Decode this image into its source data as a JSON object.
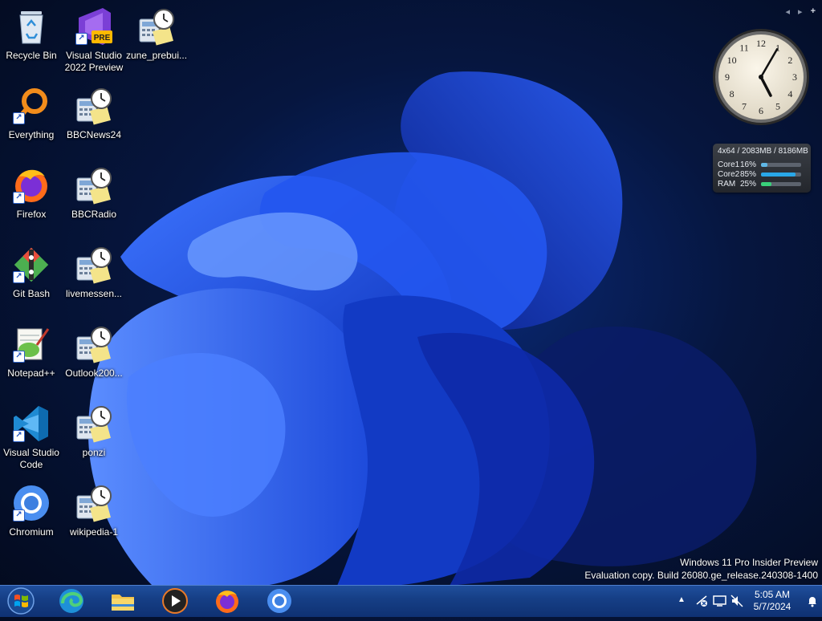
{
  "desktop": {
    "icons": [
      {
        "label": "Recycle Bin"
      },
      {
        "label": "Visual Studio 2022 Preview",
        "badge": "PRE"
      },
      {
        "label": "zune_prebui..."
      },
      {
        "label": "Everything"
      },
      {
        "label": "BBCNews24"
      },
      {
        "label": "Firefox"
      },
      {
        "label": "BBCRadio"
      },
      {
        "label": "Git Bash"
      },
      {
        "label": "livemessen..."
      },
      {
        "label": "Notepad++"
      },
      {
        "label": "Outlook200..."
      },
      {
        "label": "Visual Studio Code"
      },
      {
        "label": "ponzi"
      },
      {
        "label": "Chromium"
      },
      {
        "label": "wikipedia-1"
      }
    ]
  },
  "sidebar": {
    "prev_icon": "chevron-left-icon",
    "next_icon": "chevron-right-icon",
    "add_icon": "plus-icon",
    "add_label": "+"
  },
  "clock_gadget": {
    "numbers": [
      "12",
      "1",
      "2",
      "3",
      "4",
      "5",
      "6",
      "7",
      "8",
      "9",
      "10",
      "11"
    ],
    "hour": 5,
    "minute": 5
  },
  "cpu_gadget": {
    "title": "4x64 / 2083MB / 8186MB",
    "rows": [
      {
        "label": "Core1",
        "value": "16%",
        "fraction": 0.16,
        "color": "#5fb7e6"
      },
      {
        "label": "Core2",
        "value": "85%",
        "fraction": 0.85,
        "color": "#29a7e8"
      },
      {
        "label": "RAM",
        "value": "25%",
        "fraction": 0.25,
        "color": "#39d07a"
      }
    ]
  },
  "watermark": {
    "line1": "Windows 11 Pro Insider Preview",
    "line2": "Evaluation copy. Build 26080.ge_release.240308-1400"
  },
  "taskbar": {
    "start_icon": "windows-start-orb-icon",
    "pinned": [
      "edge-icon",
      "file-explorer-icon",
      "media-player-icon",
      "firefox-icon",
      "chromium-icon"
    ],
    "tray": {
      "time": "5:05 AM",
      "date": "5/7/2024",
      "icons": [
        "show-hidden-icons-chevron",
        "network-disconnected-icon",
        "display-icon",
        "volume-muted-icon",
        "notification-bell-icon"
      ]
    }
  },
  "colors": {
    "accent": "#1f4e9c",
    "wallpaper_blue": "#1e50e6"
  }
}
